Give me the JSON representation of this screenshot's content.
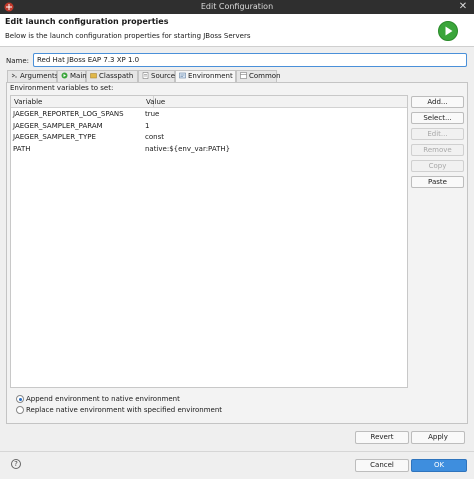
{
  "window": {
    "title": "Edit Configuration"
  },
  "header": {
    "title": "Edit launch configuration properties",
    "description": "Below is the launch configuration properties for starting JBoss Servers"
  },
  "name_field": {
    "label": "Name:",
    "value": "Red Hat JBoss EAP 7.3 XP 1.0"
  },
  "tabs": [
    {
      "label": "Arguments",
      "icon": "arguments-icon"
    },
    {
      "label": "Main",
      "icon": "main-icon"
    },
    {
      "label": "Classpath",
      "icon": "classpath-icon"
    },
    {
      "label": "Source",
      "icon": "source-icon"
    },
    {
      "label": "Environment",
      "icon": "environment-icon",
      "active": true
    },
    {
      "label": "Common",
      "icon": "common-icon"
    }
  ],
  "environment": {
    "label": "Environment variables to set:",
    "columns": [
      "Variable",
      "Value"
    ],
    "rows": [
      {
        "variable": "JAEGER_REPORTER_LOG_SPANS",
        "value": "true"
      },
      {
        "variable": "JAEGER_SAMPLER_PARAM",
        "value": "1"
      },
      {
        "variable": "JAEGER_SAMPLER_TYPE",
        "value": "const"
      },
      {
        "variable": "PATH",
        "value": "native:${env_var:PATH}"
      }
    ]
  },
  "side_buttons": {
    "add": "Add...",
    "select": "Select...",
    "edit": "Edit...",
    "remove": "Remove",
    "copy": "Copy",
    "paste": "Paste"
  },
  "radios": {
    "append": "Append environment to native environment",
    "replace": "Replace native environment with specified environment",
    "selected": "append"
  },
  "bottom": {
    "revert": "Revert",
    "apply": "Apply",
    "cancel": "Cancel",
    "ok": "OK",
    "help": "?"
  },
  "colors": {
    "accent": "#3e8ede",
    "run_green": "#3aa53a",
    "titlebar": "#2f2f2f"
  }
}
